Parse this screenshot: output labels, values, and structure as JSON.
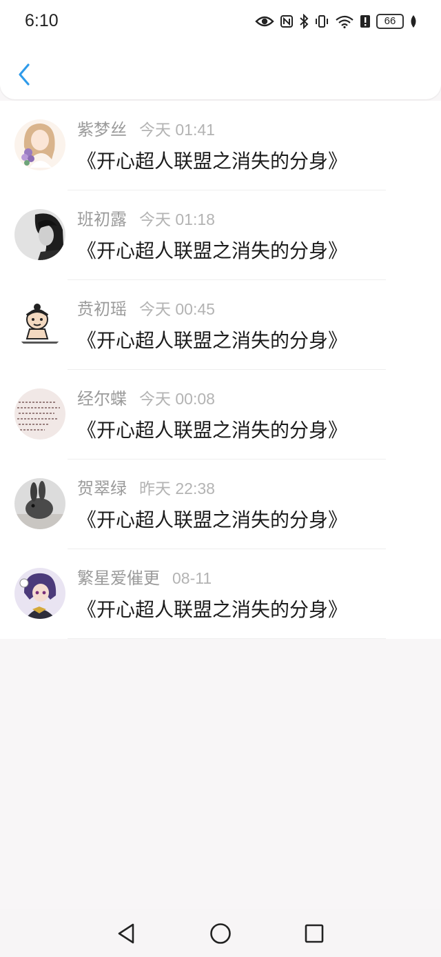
{
  "status_bar": {
    "time": "6:10",
    "battery": "66",
    "icons": [
      "eye-icon",
      "nfc-icon",
      "bluetooth-icon",
      "vibrate-icon",
      "wifi-icon",
      "alert-icon",
      "battery-icon",
      "leaf-icon"
    ]
  },
  "header": {
    "back_icon": "chevron-left-icon",
    "accent_color": "#2f9bea"
  },
  "messages": [
    {
      "name": "紫梦丝",
      "time": "今天 01:41",
      "text": "《开心超人联盟之消失的分身》",
      "avatar": "girl-flowers-avatar"
    },
    {
      "name": "班初露",
      "time": "今天 01:18",
      "text": "《开心超人联盟之消失的分身》",
      "avatar": "bw-boy-avatar"
    },
    {
      "name": "贲初瑶",
      "time": "今天 00:45",
      "text": "《开心超人联盟之消失的分身》",
      "avatar": "cartoon-meme-avatar"
    },
    {
      "name": "经尔蝶",
      "time": "今天 00:08",
      "text": "《开心超人联盟之消失的分身》",
      "avatar": "handwriting-avatar"
    },
    {
      "name": "贺翠绿",
      "time": "昨天 22:38",
      "text": "《开心超人联盟之消失的分身》",
      "avatar": "bunny-avatar"
    },
    {
      "name": "繁星爱催更",
      "time": "08-11",
      "text": "《开心超人联盟之消失的分身》",
      "avatar": "anime-character-avatar"
    }
  ],
  "nav_bar": {
    "icons": [
      "back-triangle-icon",
      "home-circle-icon",
      "recents-square-icon"
    ]
  }
}
